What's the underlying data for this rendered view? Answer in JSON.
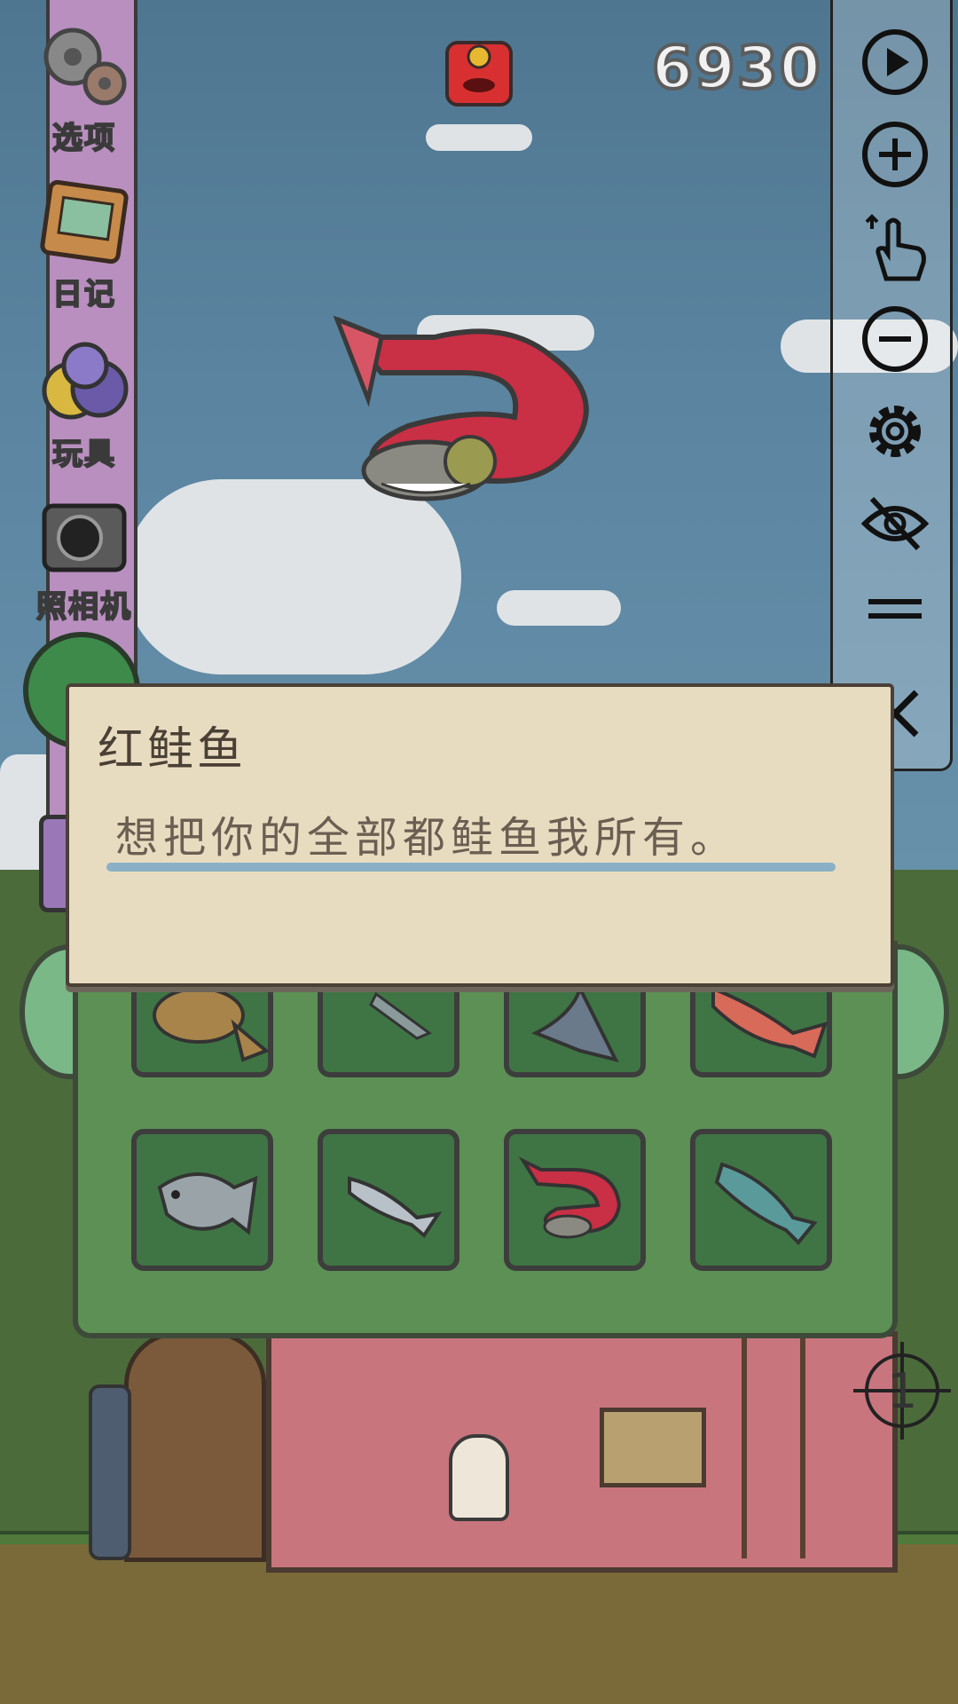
{
  "hud": {
    "score": "6930",
    "red_envelope_icon": "red-envelope-icon"
  },
  "menu": {
    "items": [
      {
        "label": "选项",
        "icon": "gears-icon"
      },
      {
        "label": "日记",
        "icon": "diary-icon"
      },
      {
        "label": "玩具",
        "icon": "toys-icon"
      },
      {
        "label": "照相机",
        "icon": "camera-icon"
      }
    ]
  },
  "toolbar": {
    "tools": [
      "play-icon",
      "zoom-in-icon",
      "tap-hand-icon",
      "zoom-out-icon",
      "gear-icon",
      "hide-eye-icon",
      "drag-handle-icon",
      "close-icon"
    ]
  },
  "dialog": {
    "title": "红鲑鱼",
    "text": "想把你的全部都鲑鱼我所有。"
  },
  "collection": {
    "slots": [
      {
        "fish": "flounder-icon"
      },
      {
        "fish": "small-fish-icon"
      },
      {
        "fish": "marlin-icon"
      },
      {
        "fish": "red-snapper-icon"
      },
      {
        "fish": "grouper-icon"
      },
      {
        "fish": "silver-fish-icon"
      },
      {
        "fish": "red-salmon-icon"
      },
      {
        "fish": "trout-icon"
      }
    ]
  },
  "crosshair": {
    "value": "1"
  },
  "colors": {
    "salmon_red": "#c92f45",
    "bag_green": "#5c9055",
    "dialog_bg": "#e8dcc0",
    "menu_pole": "#b88fbf"
  }
}
